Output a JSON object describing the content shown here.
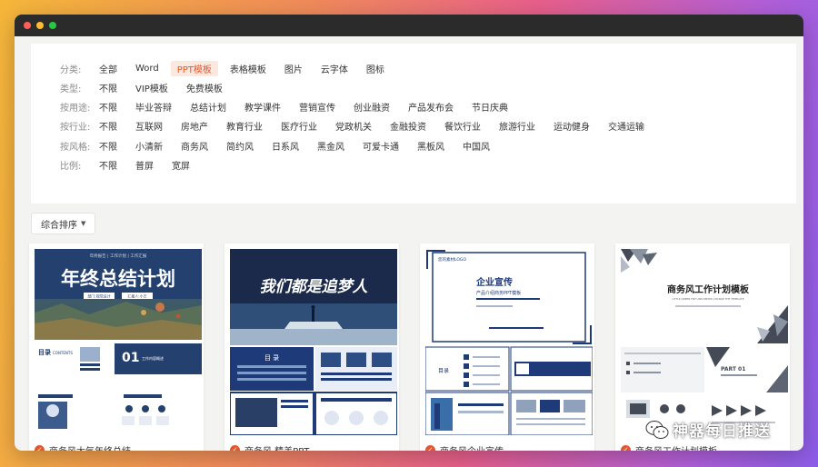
{
  "filters": [
    {
      "label": "分类:",
      "items": [
        "全部",
        "Word",
        "PPT模板",
        "表格模板",
        "图片",
        "云字体",
        "图标"
      ],
      "active": 2
    },
    {
      "label": "类型:",
      "items": [
        "不限",
        "VIP模板",
        "免费模板"
      ],
      "active": -1
    },
    {
      "label": "按用途:",
      "items": [
        "不限",
        "毕业答辩",
        "总结计划",
        "教学课件",
        "营销宣传",
        "创业融资",
        "产品发布会",
        "节日庆典"
      ],
      "active": -1
    },
    {
      "label": "按行业:",
      "items": [
        "不限",
        "互联网",
        "房地产",
        "教育行业",
        "医疗行业",
        "党政机关",
        "金融投资",
        "餐饮行业",
        "旅游行业",
        "运动健身",
        "交通运输"
      ],
      "active": -1
    },
    {
      "label": "按风格:",
      "items": [
        "不限",
        "小清新",
        "商务风",
        "简约风",
        "日系风",
        "黑金风",
        "可爱卡通",
        "黑板风",
        "中国风"
      ],
      "active": -1
    },
    {
      "label": "比例:",
      "items": [
        "不限",
        "普屏",
        "宽屏"
      ],
      "active": -1
    }
  ],
  "sort": {
    "label": "综合排序",
    "caret": "▼"
  },
  "cards": [
    {
      "title": "商务风大气年终总结",
      "badge": "✓",
      "thumb": {
        "banner_tags": "年终报告 | 工作计划 | 工作汇报",
        "heading": "年终总结计划",
        "sub_left": "部门:视觉设计",
        "sub_right": "汇报人:小王",
        "toc_label": "目录",
        "toc_en": "CONTENTS",
        "section_no": "01",
        "section_text": "工作内容概述"
      }
    },
    {
      "title": "商务风 精美PPT",
      "badge": "✓",
      "thumb": {
        "heading": "我们都是追梦人",
        "toc_label": "目 录"
      }
    },
    {
      "title": "商务风企业宣传",
      "badge": "✓",
      "thumb": {
        "logo": "您的素材LOGO",
        "heading": "企业宣传",
        "subheading": "产品介绍商务PPT模板",
        "toc_label": "目录"
      }
    },
    {
      "title": "商务风工作计划模板",
      "badge": "✓",
      "thumb": {
        "heading": "商务风工作计划模板",
        "en_line": "LITTLE GREEN FISH AND NEVER CHANGE THE TEMPLATE",
        "part": "PART 01"
      }
    }
  ],
  "watermark": {
    "text": "神器每日推送",
    "icon": "wechat-icon"
  },
  "colors": {
    "accent": "#e2572b",
    "navy": "#1e3a78",
    "window": "#2b2b2b"
  }
}
